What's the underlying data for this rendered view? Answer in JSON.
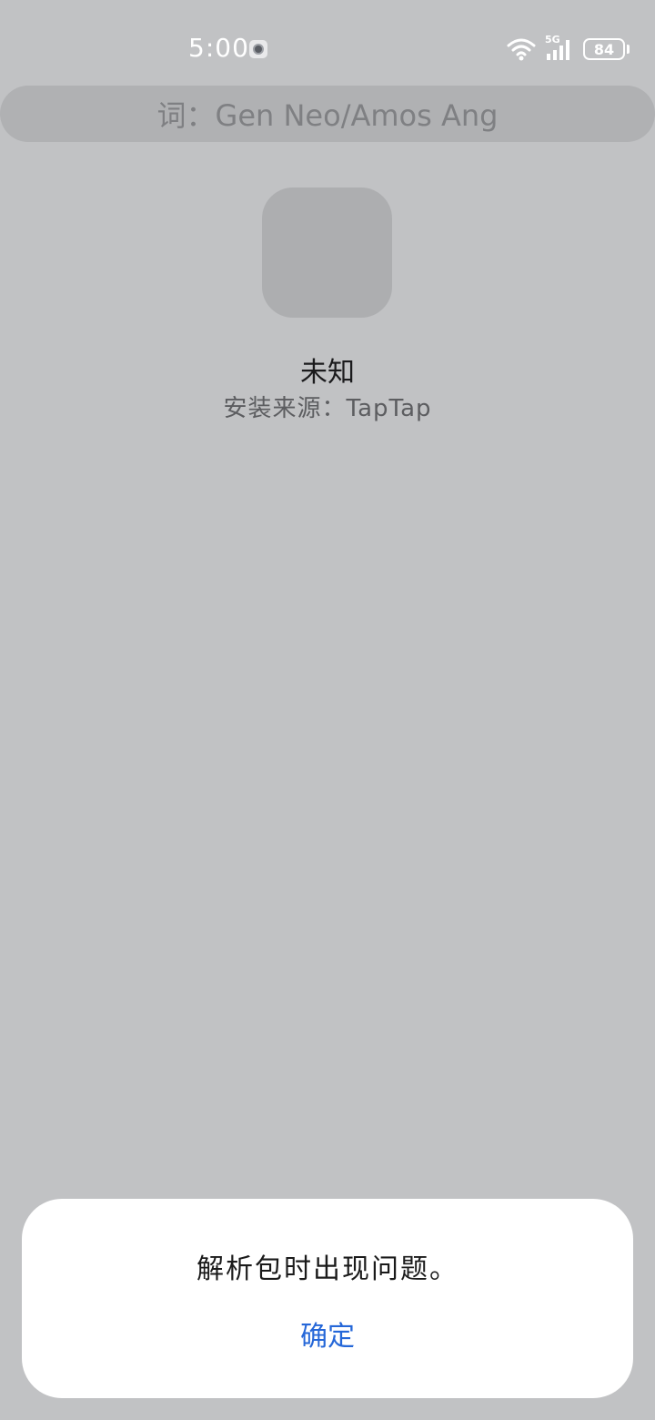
{
  "status_bar": {
    "time": "5:00",
    "network": "5G",
    "battery": "84",
    "icon_names": [
      "camera-notification-icon",
      "wifi-icon",
      "signal-icon",
      "battery-icon"
    ]
  },
  "lyric": {
    "text": "词：Gen Neo/Amos Ang"
  },
  "app": {
    "name": "未知",
    "install_source": "安装来源：TapTap"
  },
  "dialog": {
    "message": "解析包时出现问题。",
    "confirm_label": "确定"
  },
  "colors": {
    "background": "#c1c2c4",
    "dialog_background": "#ffffff",
    "accent": "#2567d8"
  }
}
